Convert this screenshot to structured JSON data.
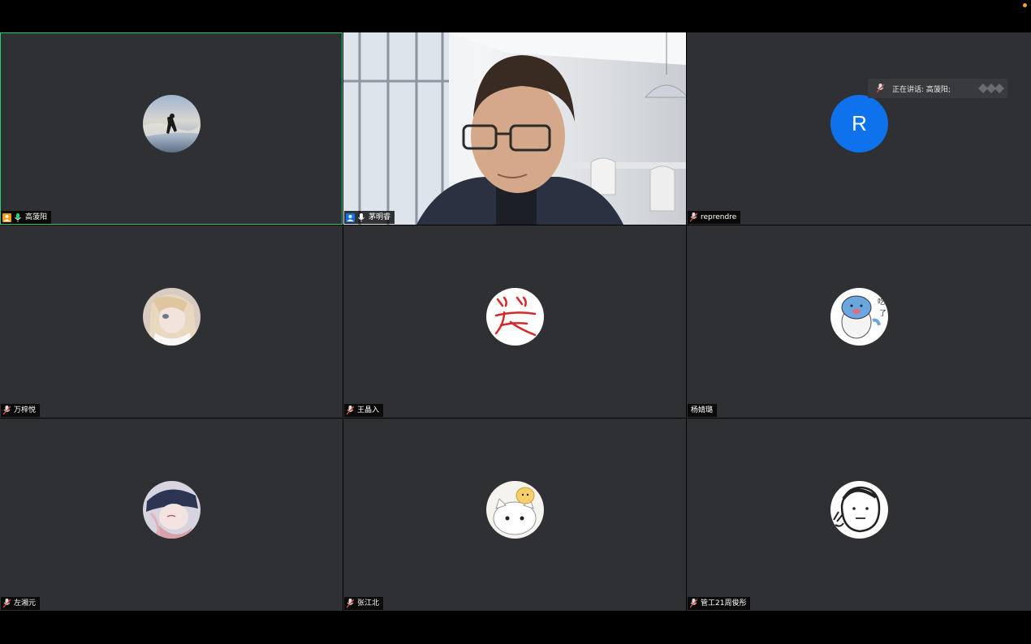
{
  "window": {
    "recording_indicator_color": "#f5a623"
  },
  "participants": [
    {
      "name": "高菠阳",
      "mic": "active",
      "host": true,
      "avatar_icon": "surfer-photo-avatar",
      "active_speaker": true
    },
    {
      "name": "茅明睿",
      "mic": "on",
      "host": true,
      "avatar_icon": "camera-video-feed",
      "video": true
    },
    {
      "name": "reprendre",
      "mic": "muted",
      "host": false,
      "avatar_letter": "R",
      "avatar_color": "#0e72ed"
    },
    {
      "name": "万梓悦",
      "mic": "muted",
      "host": false,
      "avatar_icon": "anime-character-avatar"
    },
    {
      "name": "王晶入",
      "mic": "muted",
      "host": false,
      "avatar_icon": "calligraphy-xiao-avatar"
    },
    {
      "name": "杨婧璐",
      "mic": "none",
      "host": false,
      "avatar_icon": "cartoon-seal-avatar"
    },
    {
      "name": "左湘元",
      "mic": "muted",
      "host": false,
      "avatar_icon": "anime-cap-avatar"
    },
    {
      "name": "张江北",
      "mic": "muted",
      "host": false,
      "avatar_icon": "cat-with-crown-avatar"
    },
    {
      "name": "管工21周俊彤",
      "mic": "muted",
      "host": false,
      "avatar_icon": "doodle-face-avatar"
    }
  ],
  "speaker_bar": {
    "label": "正在讲话: 高菠阳;",
    "icon": "muted-mic-icon"
  },
  "colors": {
    "tile_bg": "#2f3033",
    "active_border": "#2ecc71",
    "host_badge_orange": "#f39c12",
    "host_badge_blue": "#0e72ed",
    "mic_active": "#2ecc71"
  }
}
